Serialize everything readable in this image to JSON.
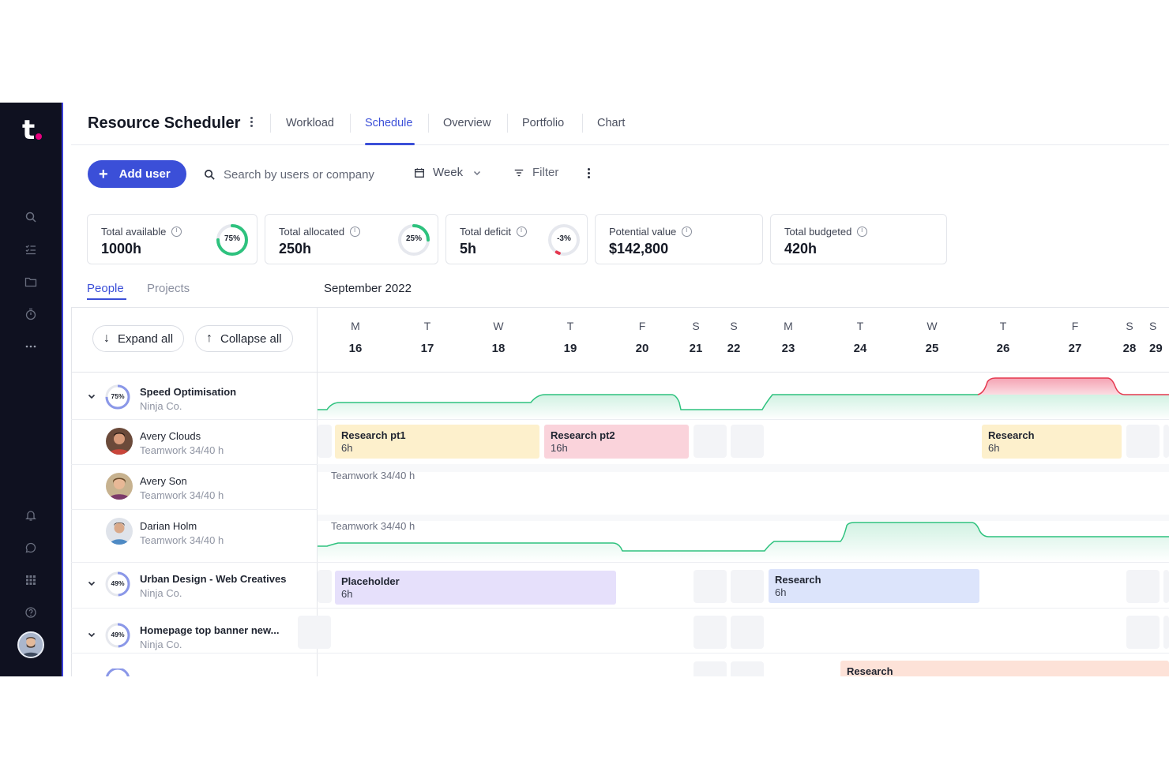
{
  "app": {
    "logo_letter": "t",
    "title": "Resource Scheduler",
    "accent_color": "#3b4fd8"
  },
  "tabs": [
    {
      "label": "Workload"
    },
    {
      "label": "Schedule"
    },
    {
      "label": "Overview"
    },
    {
      "label": "Portfolio"
    },
    {
      "label": "Chart"
    }
  ],
  "toolbar": {
    "add_user_label": "Add user",
    "search_placeholder": "Search by users or company",
    "view_label": "Week",
    "filter_label": "Filter"
  },
  "stats": [
    {
      "label": "Total available",
      "value": "1000h",
      "ring_text": "75%",
      "ring_fraction": 0.75,
      "ring_color": "#2ec27e"
    },
    {
      "label": "Total allocated",
      "value": "250h",
      "ring_text": "25%",
      "ring_fraction": 0.25,
      "ring_color": "#2ec27e"
    },
    {
      "label": "Total deficit",
      "value": "5h",
      "ring_text": "-3%",
      "ring_fraction": 0.03,
      "ring_color": "#e5384f"
    },
    {
      "label": "Potential value",
      "value": "$142,800"
    },
    {
      "label": "Total budgeted",
      "value": "420h"
    }
  ],
  "view_tabs": {
    "people": "People",
    "projects": "Projects"
  },
  "month_label": "September 2022",
  "controls": {
    "expand_all": "Expand all",
    "collapse_all": "Collapse all"
  },
  "days": [
    {
      "dow": "M",
      "num": "16"
    },
    {
      "dow": "T",
      "num": "17"
    },
    {
      "dow": "W",
      "num": "18"
    },
    {
      "dow": "T",
      "num": "19"
    },
    {
      "dow": "F",
      "num": "20"
    },
    {
      "dow": "S",
      "num": "21"
    },
    {
      "dow": "S",
      "num": "22"
    },
    {
      "dow": "M",
      "num": "23"
    },
    {
      "dow": "T",
      "num": "24"
    },
    {
      "dow": "W",
      "num": "25"
    },
    {
      "dow": "T",
      "num": "26"
    },
    {
      "dow": "F",
      "num": "27"
    },
    {
      "dow": "S",
      "num": "28"
    },
    {
      "dow": "S",
      "num": "29"
    }
  ],
  "rows": {
    "project1": {
      "title": "Speed Optimisation",
      "company": "Ninja Co.",
      "ring_text": "75%",
      "ring_fraction": 0.75
    },
    "person1": {
      "name": "Avery Clouds",
      "detail": "Teamwork  34/40 h"
    },
    "person2": {
      "name": "Avery Son",
      "detail": "Teamwork  34/40 h"
    },
    "person3": {
      "name": "Darian Holm",
      "detail": "Teamwork  34/40 h"
    },
    "project2": {
      "title": "Urban Design - Web Creatives",
      "company": "Ninja Co.",
      "ring_text": "49%",
      "ring_fraction": 0.49
    },
    "project3": {
      "title": "Homepage top banner new...",
      "company": "Ninja Co.",
      "ring_text": "49%",
      "ring_fraction": 0.49
    }
  },
  "capacity_labels": {
    "person2": "Teamwork  34/40 h",
    "person3": "Teamwork  34/40 h"
  },
  "tasks": {
    "t1": {
      "name": "Research pt1",
      "hours": "6h",
      "color": "#fdf0cc"
    },
    "t2": {
      "name": "Research  pt2",
      "hours": "16h",
      "color": "#fad3db"
    },
    "t3": {
      "name": "Research",
      "hours": "6h",
      "color": "#fdf0cc"
    },
    "t4": {
      "name": "Placeholder",
      "hours": "6h",
      "color": "#e6e0fb"
    },
    "t5": {
      "name": "Research",
      "hours": "6h",
      "color": "#dce4fb"
    },
    "t6": {
      "name": "Research",
      "color": "#fde2d8"
    }
  },
  "icons": [
    "search-icon",
    "tasks-icon",
    "folder-icon",
    "timer-icon",
    "more-icon",
    "bell-icon",
    "chat-icon",
    "apps-icon",
    "help-icon",
    "calendar-icon",
    "chevron-down-icon",
    "filter-icon",
    "plus-icon",
    "info-icon"
  ]
}
